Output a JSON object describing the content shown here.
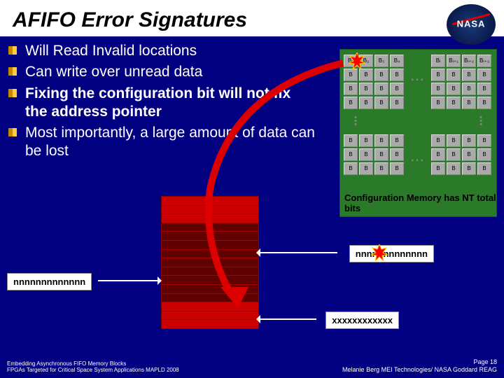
{
  "title": "AFIFO Error Signatures",
  "logo_text": "NASA",
  "bullets": [
    {
      "text": "Will Read Invalid locations",
      "bold": false
    },
    {
      "text": "Can write over unread data",
      "bold": false
    },
    {
      "text": "Fixing the configuration bit will not fix the address pointer",
      "bold": true
    },
    {
      "text": "Most importantly, a large amount of data can be lost",
      "bold": false
    }
  ],
  "config_mem": {
    "caption": "Configuration Memory has NT total bits",
    "chip_labels_top": [
      "B₁",
      "B₂",
      "B₃",
      "B₄"
    ],
    "chip_labels_top_right": [
      "Bᵢ",
      "Bᵢ₊₁",
      "Bᵢ₊₂",
      "Bᵢ₊₃"
    ],
    "chip_generic": "B"
  },
  "labels": {
    "rdptr_expected": "nnnnnnnnnnnnn",
    "rdptr_actual": "nnnnnnnnnnnnn",
    "wrptr": "xxxxxxxxxxxx"
  },
  "footer": {
    "left_line1": "Embedding Asynchronous FIFO Memory Blocks",
    "left_line2": "FPGAs Targeted for Critical Space System Applications MAPLD 2008",
    "right_line1": "Page 18",
    "right_line2": "Melanie Berg MEI Technologies/ NASA Goddard REAG"
  }
}
